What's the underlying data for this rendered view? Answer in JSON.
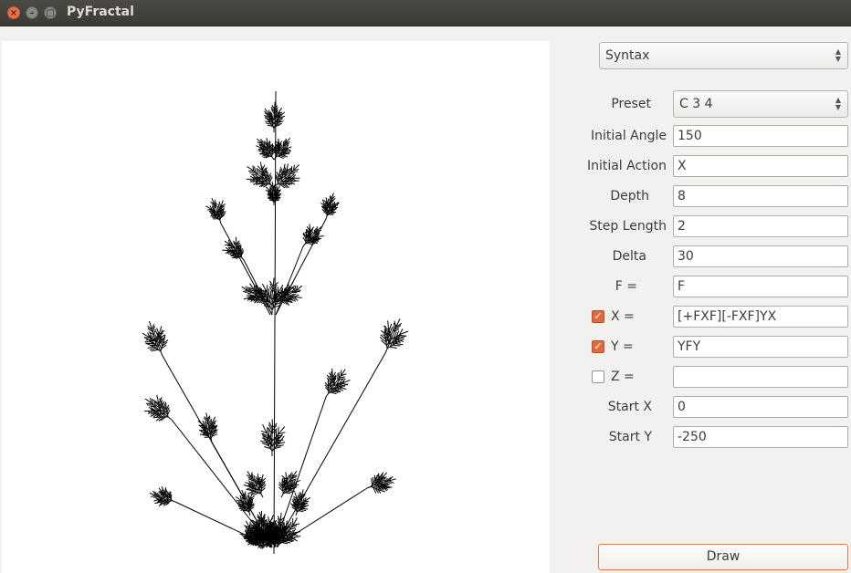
{
  "window": {
    "title": "PyFractal",
    "close_glyph": "×",
    "min_glyph": "–",
    "max_glyph": "□"
  },
  "mode_select": {
    "value": "Syntax"
  },
  "preset": {
    "label": "Preset",
    "value": "C 3 4"
  },
  "fields": {
    "initial_angle": {
      "label": "Initial Angle",
      "value": "150"
    },
    "initial_action": {
      "label": "Initial Action",
      "value": "X"
    },
    "depth": {
      "label": "Depth",
      "value": "8"
    },
    "step_length": {
      "label": "Step Length",
      "value": "2"
    },
    "delta": {
      "label": "Delta",
      "value": "30"
    },
    "f_rule": {
      "label": "F =",
      "value": "F"
    },
    "x_rule": {
      "label": "X =",
      "value": "[+FXF][-FXF]YX",
      "checked": true
    },
    "y_rule": {
      "label": "Y =",
      "value": "YFY",
      "checked": true
    },
    "z_rule": {
      "label": "Z =",
      "value": "",
      "checked": false
    },
    "start_x": {
      "label": "Start X",
      "value": "0"
    },
    "start_y": {
      "label": "Start Y",
      "value": "-250"
    }
  },
  "draw_button": {
    "label": "Draw"
  },
  "colors": {
    "accent": "#e1693e",
    "titlebar": "#3b3a36",
    "fractal": "#000000"
  },
  "icons": {
    "check": "✓",
    "updown": "▲▼"
  }
}
